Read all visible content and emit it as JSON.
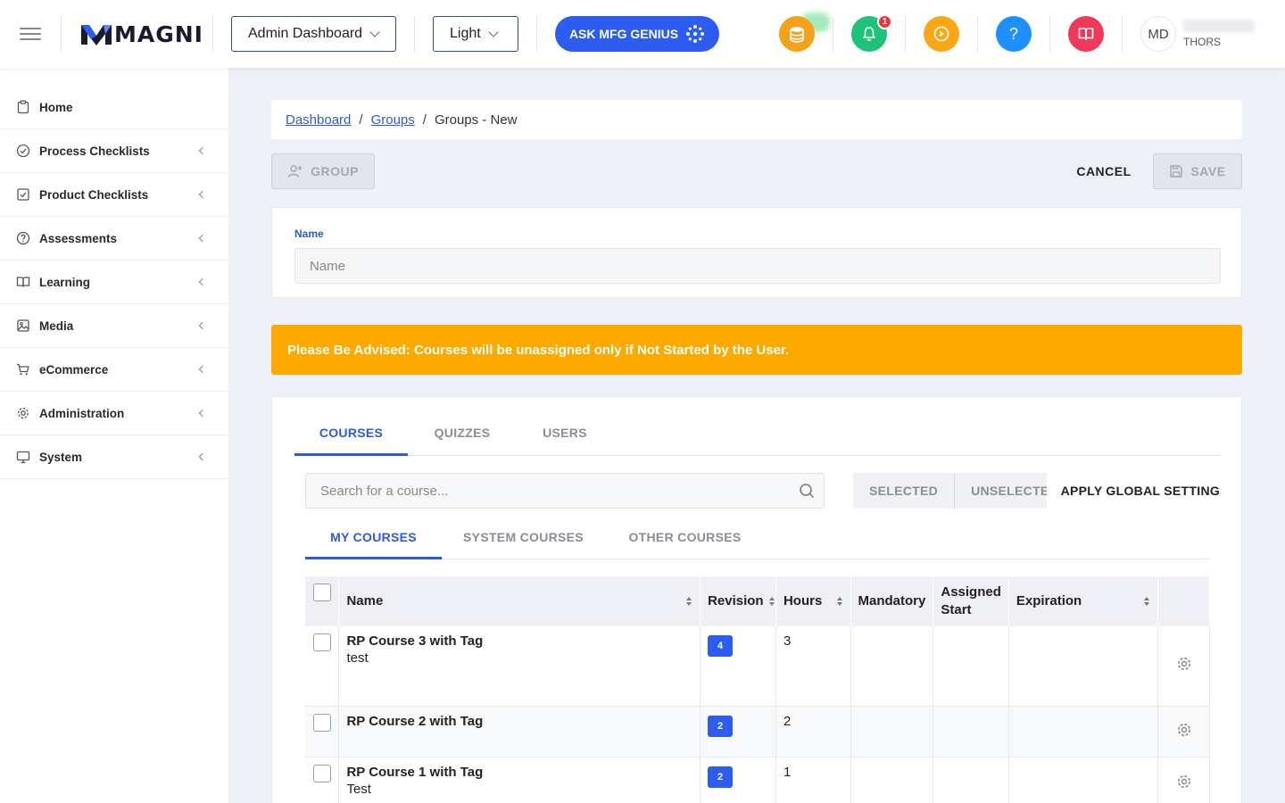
{
  "header": {
    "brand": "MAGNI",
    "dashboard_select": "Admin Dashboard",
    "theme_select": "Light",
    "ask_button": "ASK MFG GENIUS",
    "notification_count": "1",
    "avatar_initials": "MD",
    "user_org": "THORS",
    "icons": {
      "coins": {
        "name": "coins-icon",
        "color": "#f4a21b"
      },
      "bell": {
        "name": "bell-icon",
        "color": "#1ec279"
      },
      "play": {
        "name": "play-icon",
        "color": "#fba617"
      },
      "help": {
        "name": "help-icon",
        "color": "#1e90ff"
      },
      "book": {
        "name": "book-icon",
        "color": "#f0385a"
      }
    }
  },
  "sidebar": {
    "items": [
      {
        "label": "Home",
        "icon": "clipboard-icon",
        "has_submenu": false
      },
      {
        "label": "Process Checklists",
        "icon": "check-circle-icon",
        "has_submenu": true
      },
      {
        "label": "Product Checklists",
        "icon": "check-square-icon",
        "has_submenu": true
      },
      {
        "label": "Assessments",
        "icon": "question-circle-icon",
        "has_submenu": true
      },
      {
        "label": "Learning",
        "icon": "open-book-icon",
        "has_submenu": true
      },
      {
        "label": "Media",
        "icon": "image-icon",
        "has_submenu": true
      },
      {
        "label": "eCommerce",
        "icon": "cart-icon",
        "has_submenu": true
      },
      {
        "label": "Administration",
        "icon": "gear-icon",
        "has_submenu": true
      },
      {
        "label": "System",
        "icon": "monitor-icon",
        "has_submenu": true
      }
    ]
  },
  "breadcrumb": {
    "items": [
      "Dashboard",
      "Groups"
    ],
    "current": "Groups - New"
  },
  "toolbar": {
    "group_label": "GROUP",
    "cancel_label": "CANCEL",
    "save_label": "SAVE"
  },
  "form": {
    "name_label": "Name",
    "name_placeholder": "Name",
    "name_value": ""
  },
  "alert": {
    "text": "Please Be Advised: Courses will be unassigned only if Not Started by the User.",
    "color": "#fdaa00"
  },
  "tabs": {
    "main": [
      "COURSES",
      "QUIZZES",
      "USERS"
    ],
    "active_main": "COURSES",
    "search_placeholder": "Search for a course...",
    "filters": {
      "selected": "SELECTED",
      "unselected": "UNSELECTED",
      "global": "APPLY GLOBAL SETTINGS"
    },
    "sub": [
      "MY COURSES",
      "SYSTEM COURSES",
      "OTHER COURSES"
    ],
    "active_sub": "MY COURSES"
  },
  "table": {
    "columns": {
      "name": "Name",
      "revision": "Revision",
      "hours": "Hours",
      "mandatory": "Mandatory",
      "assigned_start": "Assigned Start",
      "expiration": "Expiration"
    },
    "rows": [
      {
        "title": "RP Course 3 with Tag",
        "subtitle": "test",
        "revision": "4",
        "hours": "3"
      },
      {
        "title": "RP Course 2 with Tag",
        "subtitle": "",
        "revision": "2",
        "hours": "2"
      },
      {
        "title": "RP Course 1 with Tag",
        "subtitle": "Test",
        "revision": "2",
        "hours": "1"
      }
    ]
  }
}
